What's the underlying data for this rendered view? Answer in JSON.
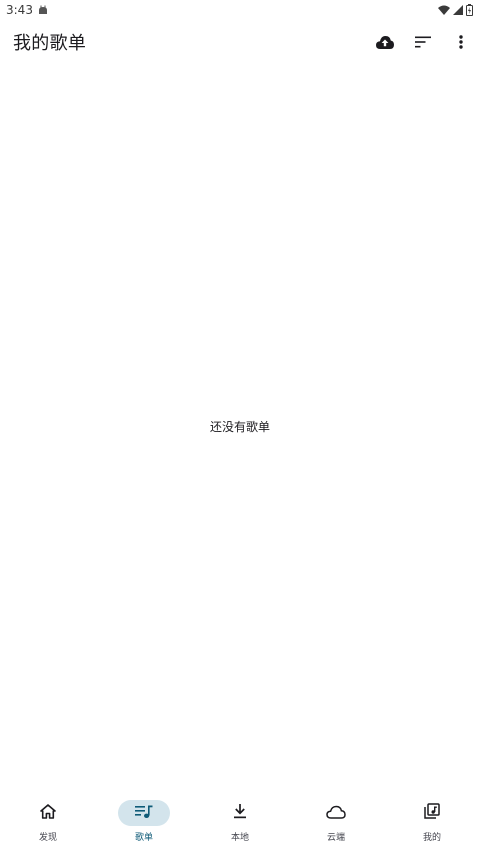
{
  "status_bar": {
    "time": "3:43",
    "icons": [
      "android-notification-icon",
      "wifi-icon",
      "signal-icon",
      "battery-icon"
    ]
  },
  "app_bar": {
    "title": "我的歌单",
    "actions": [
      "cloud-upload-icon",
      "sort-icon",
      "more-vert-icon"
    ]
  },
  "main": {
    "empty_message": "还没有歌单"
  },
  "bottom_nav": {
    "items": [
      {
        "label": "发现",
        "icon": "home-icon",
        "active": false
      },
      {
        "label": "歌单",
        "icon": "queue-music-icon",
        "active": true
      },
      {
        "label": "本地",
        "icon": "download-icon",
        "active": false
      },
      {
        "label": "云端",
        "icon": "cloud-icon",
        "active": false
      },
      {
        "label": "我的",
        "icon": "library-music-icon",
        "active": false
      }
    ]
  },
  "colors": {
    "background": "#ffffff",
    "text": "#1c1b1f",
    "active_indicator": "#d3e4ec",
    "active_accent": "#0f5b78",
    "inactive_label": "#45464f"
  }
}
